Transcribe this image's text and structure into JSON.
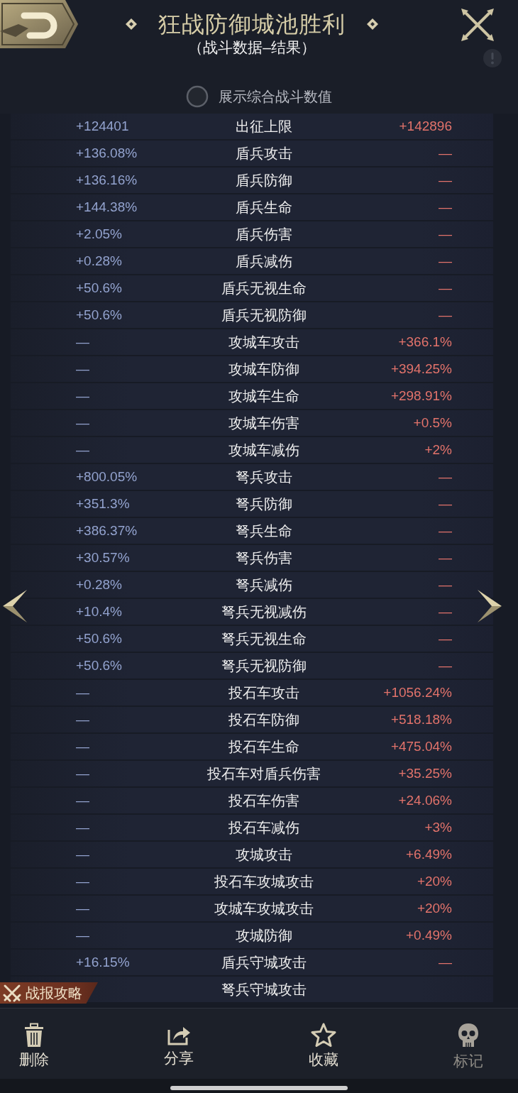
{
  "header": {
    "title": "狂战防御城池胜利",
    "subtitle": "（战斗数据–结果）"
  },
  "toggle": {
    "label": "展示综合战斗数值",
    "checked": false
  },
  "stats": {
    "rows": [
      {
        "left": "+124401",
        "name": "出征上限",
        "right": "+142896"
      },
      {
        "left": "+136.08%",
        "name": "盾兵攻击",
        "right": "—"
      },
      {
        "left": "+136.16%",
        "name": "盾兵防御",
        "right": "—"
      },
      {
        "left": "+144.38%",
        "name": "盾兵生命",
        "right": "—"
      },
      {
        "left": "+2.05%",
        "name": "盾兵伤害",
        "right": "—"
      },
      {
        "left": "+0.28%",
        "name": "盾兵减伤",
        "right": "—"
      },
      {
        "left": "+50.6%",
        "name": "盾兵无视生命",
        "right": "—"
      },
      {
        "left": "+50.6%",
        "name": "盾兵无视防御",
        "right": "—"
      },
      {
        "left": "—",
        "name": "攻城车攻击",
        "right": "+366.1%"
      },
      {
        "left": "—",
        "name": "攻城车防御",
        "right": "+394.25%"
      },
      {
        "left": "—",
        "name": "攻城车生命",
        "right": "+298.91%"
      },
      {
        "left": "—",
        "name": "攻城车伤害",
        "right": "+0.5%"
      },
      {
        "left": "—",
        "name": "攻城车减伤",
        "right": "+2%"
      },
      {
        "left": "+800.05%",
        "name": "弩兵攻击",
        "right": "—"
      },
      {
        "left": "+351.3%",
        "name": "弩兵防御",
        "right": "—"
      },
      {
        "left": "+386.37%",
        "name": "弩兵生命",
        "right": "—"
      },
      {
        "left": "+30.57%",
        "name": "弩兵伤害",
        "right": "—"
      },
      {
        "left": "+0.28%",
        "name": "弩兵减伤",
        "right": "—"
      },
      {
        "left": "+10.4%",
        "name": "弩兵无视减伤",
        "right": "—"
      },
      {
        "left": "+50.6%",
        "name": "弩兵无视生命",
        "right": "—"
      },
      {
        "left": "+50.6%",
        "name": "弩兵无视防御",
        "right": "—"
      },
      {
        "left": "—",
        "name": "投石车攻击",
        "right": "+1056.24%"
      },
      {
        "left": "—",
        "name": "投石车防御",
        "right": "+518.18%"
      },
      {
        "left": "—",
        "name": "投石车生命",
        "right": "+475.04%"
      },
      {
        "left": "—",
        "name": "投石车对盾兵伤害",
        "right": "+35.25%"
      },
      {
        "left": "—",
        "name": "投石车伤害",
        "right": "+24.06%"
      },
      {
        "left": "—",
        "name": "投石车减伤",
        "right": "+3%"
      },
      {
        "left": "—",
        "name": "攻城攻击",
        "right": "+6.49%"
      },
      {
        "left": "—",
        "name": "投石车攻城攻击",
        "right": "+20%"
      },
      {
        "left": "—",
        "name": "攻城车攻城攻击",
        "right": "+20%"
      },
      {
        "left": "—",
        "name": "攻城防御",
        "right": "+0.49%"
      },
      {
        "left": "+16.15%",
        "name": "盾兵守城攻击",
        "right": "—"
      },
      {
        "name": "弩兵守城攻击"
      }
    ]
  },
  "guide_badge": {
    "label": "战报攻略"
  },
  "actions": [
    {
      "kind": "delete",
      "label": "删除",
      "disabled": false
    },
    {
      "kind": "share",
      "label": "分享",
      "disabled": false
    },
    {
      "kind": "favorite",
      "label": "收藏",
      "disabled": false
    },
    {
      "kind": "mark",
      "label": "标记",
      "disabled": true
    }
  ]
}
